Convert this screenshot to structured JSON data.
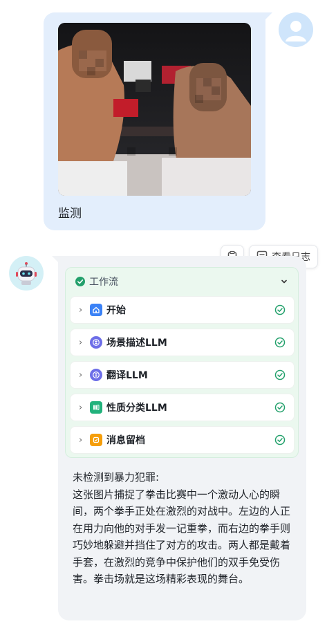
{
  "user_message": {
    "text": "监测",
    "image_alt": "boxing match photo (pixelated faces)"
  },
  "toolbar": {
    "copy_icon": "clipboard-icon",
    "view_log_label": "查看日志"
  },
  "workflow": {
    "title": "工作流",
    "status": "completed",
    "steps": [
      {
        "label": "开始",
        "icon": "home-icon",
        "color": "#3b82f6",
        "status": "success"
      },
      {
        "label": "场景描述LLM",
        "icon": "llm-icon",
        "color": "#6d6ee8",
        "status": "success"
      },
      {
        "label": "翻译LLM",
        "icon": "llm-icon",
        "color": "#6d6ee8",
        "status": "success"
      },
      {
        "label": "性质分类LLM",
        "icon": "classifier-icon",
        "color": "#22b27c",
        "status": "success"
      },
      {
        "label": "消息留档",
        "icon": "archive-icon",
        "color": "#f59e0b",
        "status": "success"
      }
    ]
  },
  "result": {
    "heading": "未检测到暴力犯罪:",
    "body": "这张图片捕捉了拳击比赛中一个激动人心的瞬间，两个拳手正处在激烈的对战中。左边的人正在用力向他的对手发一记重拳，而右边的拳手则巧妙地躲避并挡住了对方的攻击。两人都是戴着手套，在激烈的竞争中保护他们的双手免受伤害。拳击场就是这场精彩表现的舞台。"
  },
  "colors": {
    "user_bubble": "#e3eefc",
    "bot_bubble": "#f1f3f6",
    "workflow_bg": "#ebf8ef",
    "success_green": "#22a06b"
  }
}
